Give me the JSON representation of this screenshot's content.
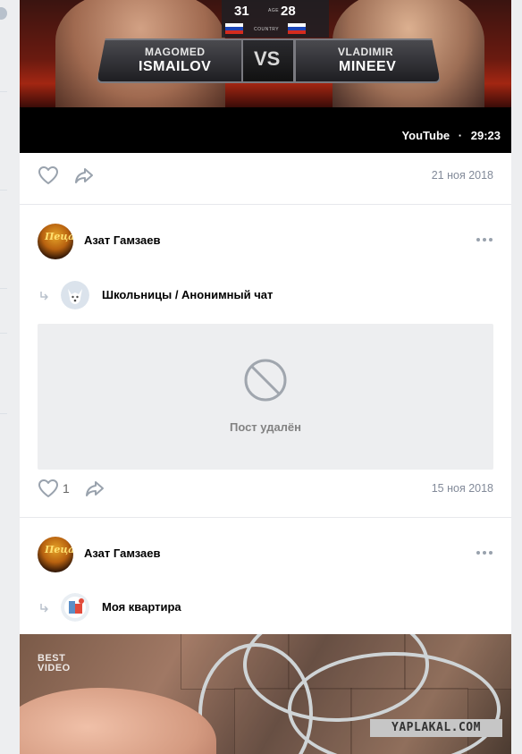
{
  "video": {
    "fighter_left": {
      "first": "MAGOMED",
      "last": "ISMAILOV",
      "age": "31"
    },
    "fighter_right": {
      "first": "VLADIMIR",
      "last": "MINEEV",
      "age": "28"
    },
    "age_label": "AGE",
    "country_label": "COUNTRY",
    "vs": "VS",
    "source": "YouTube",
    "separator": "·",
    "duration": "29:23"
  },
  "post1_actions": {
    "date": "21 ноя 2018"
  },
  "post2": {
    "author": "Азат Гамзаев",
    "avatar_text": "Пеца",
    "repost_source": "Школьницы / Анонимный чат",
    "deleted_text": "Пост удалён",
    "likes": "1",
    "date": "15 ноя 2018"
  },
  "post3": {
    "author": "Азат Гамзаев",
    "avatar_text": "Пеца",
    "repost_source": "Моя квартира",
    "video_logo_1": "BEST",
    "video_logo_2": "VIDEO",
    "watermark": "YAPLAKAL.COM"
  },
  "colors": {
    "background": "#edeef0",
    "card": "#ffffff",
    "muted": "#828a99",
    "icon": "#99a2ad"
  }
}
